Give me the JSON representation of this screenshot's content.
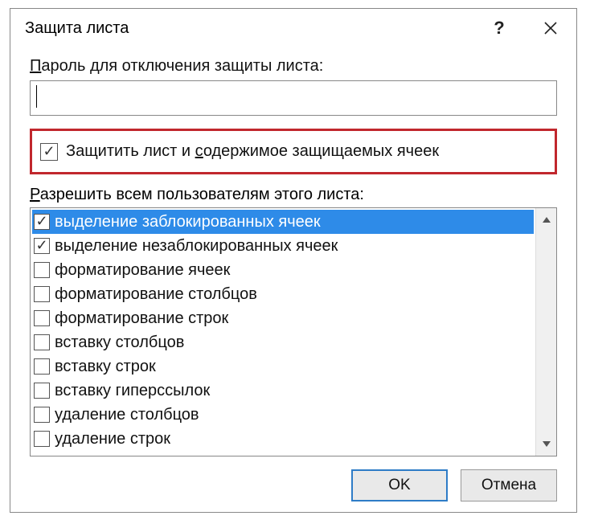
{
  "titlebar": {
    "title": "Защита листа",
    "help": "?",
    "close": "✕"
  },
  "password": {
    "label_pre": "",
    "label_u": "П",
    "label_post": "ароль для отключения защиты листа:",
    "value": ""
  },
  "protect": {
    "checked": true,
    "label_pre": "Защитить лист и ",
    "label_u": "с",
    "label_post": "одержимое защищаемых ячеек"
  },
  "permissions": {
    "label_pre": "",
    "label_u": "Р",
    "label_post": "азрешить всем пользователям этого листа:",
    "items": [
      {
        "label": "выделение заблокированных ячеек",
        "checked": true,
        "selected": true
      },
      {
        "label": "выделение незаблокированных ячеек",
        "checked": true,
        "selected": false
      },
      {
        "label": "форматирование ячеек",
        "checked": false,
        "selected": false
      },
      {
        "label": "форматирование столбцов",
        "checked": false,
        "selected": false
      },
      {
        "label": "форматирование строк",
        "checked": false,
        "selected": false
      },
      {
        "label": "вставку столбцов",
        "checked": false,
        "selected": false
      },
      {
        "label": "вставку строк",
        "checked": false,
        "selected": false
      },
      {
        "label": "вставку гиперссылок",
        "checked": false,
        "selected": false
      },
      {
        "label": "удаление столбцов",
        "checked": false,
        "selected": false
      },
      {
        "label": "удаление строк",
        "checked": false,
        "selected": false
      }
    ]
  },
  "buttons": {
    "ok": "OK",
    "cancel": "Отмена"
  },
  "colors": {
    "highlight": "#c1272d",
    "selection": "#2e8be8"
  }
}
